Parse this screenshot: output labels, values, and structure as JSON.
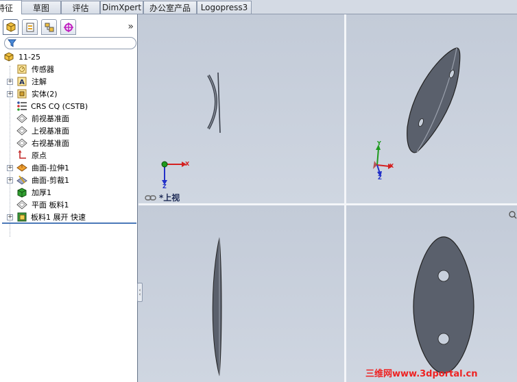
{
  "tabs": [
    {
      "label": "特征",
      "active": true
    },
    {
      "label": "草图"
    },
    {
      "label": "评估"
    },
    {
      "label": "DimXpert"
    },
    {
      "label": "办公室产品"
    },
    {
      "label": "Logopress3"
    }
  ],
  "panel_tabs": [
    {
      "icon": "feature-manager-icon"
    },
    {
      "icon": "property-manager-icon"
    },
    {
      "icon": "configuration-manager-icon"
    },
    {
      "icon": "dimxpert-manager-icon"
    }
  ],
  "panel_more": "»",
  "filter_icon": "filter-icon",
  "tree": [
    {
      "label": "11-25",
      "icon": "part-icon",
      "expander": false
    },
    {
      "label": "传感器",
      "icon": "sensor-icon",
      "expander": false
    },
    {
      "label": "注解",
      "icon": "annotation-icon",
      "expander": true
    },
    {
      "label": "实体(2)",
      "icon": "solid-bodies-icon",
      "expander": true
    },
    {
      "label": "CRS CQ (CSTB)",
      "icon": "material-icon",
      "expander": false
    },
    {
      "label": "前视基准面",
      "icon": "plane-icon",
      "expander": false
    },
    {
      "label": "上视基准面",
      "icon": "plane-icon",
      "expander": false
    },
    {
      "label": "右视基准面",
      "icon": "plane-icon",
      "expander": false
    },
    {
      "label": "原点",
      "icon": "origin-icon",
      "expander": false
    },
    {
      "label": "曲面-拉伸1",
      "icon": "surface-extrude-icon",
      "expander": true
    },
    {
      "label": "曲面-剪裁1",
      "icon": "surface-trim-icon",
      "expander": true
    },
    {
      "label": "加厚1",
      "icon": "thicken-icon",
      "expander": false
    },
    {
      "label": "平面 板料1",
      "icon": "plane-icon",
      "expander": false
    },
    {
      "label": "板料1 展开 快速",
      "icon": "sheet-flatten-icon",
      "expander": true
    }
  ],
  "viewport_label": "*上视",
  "axes": {
    "x": "X",
    "y": "Y",
    "z": "Z"
  },
  "watermark": "三维网www.3dportal.cn",
  "colors": {
    "viewport_bg": "#c8d0dc",
    "part_fill": "#5a606c",
    "axis_x": "#d42020",
    "axis_y": "#1e9a1e",
    "axis_z": "#2230c8",
    "watermark": "#ee2222"
  }
}
